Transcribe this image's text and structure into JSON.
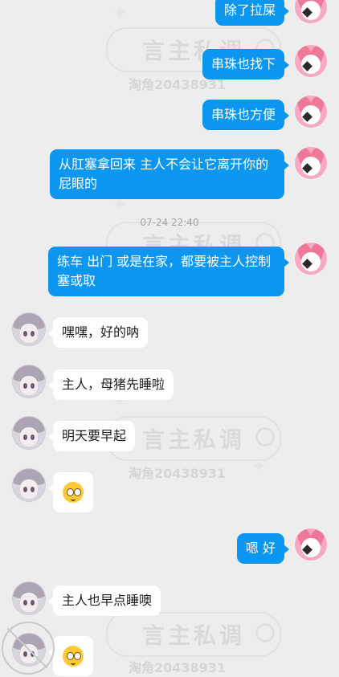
{
  "watermark": {
    "brand": "言主私调",
    "account": "淘角20438931"
  },
  "timestamp": "07-24 22:40",
  "messages": [
    {
      "text": "除了拉屎"
    },
    {
      "text": "串珠也找下"
    },
    {
      "text": "串珠也方便"
    },
    {
      "text": "从肛塞拿回来 主人不会让它离开你的屁眼的"
    },
    {
      "text": "练车 出门 或是在家，都要被主人控制塞或取"
    },
    {
      "text": "嘿嘿，好的呐"
    },
    {
      "text": "主人，母猪先睡啦"
    },
    {
      "text": "明天要早起"
    },
    {
      "emoji": "pleading-face-emoji"
    },
    {
      "text": "嗯 好"
    },
    {
      "text": "主人也早点睡噢"
    },
    {
      "emoji": "pleading-face-emoji"
    }
  ],
  "colors": {
    "outgoing_bubble": "#0b96f0",
    "incoming_bubble": "#ffffff",
    "background": "#ededed"
  }
}
